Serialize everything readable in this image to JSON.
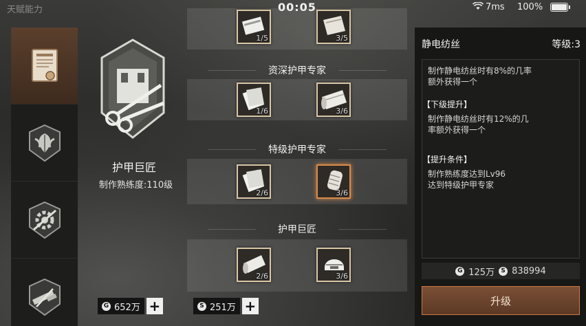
{
  "status_bar": {
    "ghost_text": "天赋能力",
    "time": "00:05",
    "network": "7ms",
    "battery": "100%"
  },
  "sidebar": {
    "categories": [
      {
        "icon": "certificate-icon",
        "active": true
      },
      {
        "icon": "leaf-emblem-icon",
        "active": false
      },
      {
        "icon": "gear-tools-icon",
        "active": false
      },
      {
        "icon": "weapon-tools-icon",
        "active": false
      }
    ]
  },
  "featured": {
    "icon": "armor-tailor-emblem-icon",
    "name": "护甲巨匠",
    "level_text": "制作熟练度:110级"
  },
  "currency": {
    "gold": "652万",
    "silver": "251万",
    "gold_symbol": "G",
    "silver_symbol": "S"
  },
  "tree": {
    "tiers": [
      {
        "title": "",
        "items": [
          {
            "count": "1/5"
          },
          {
            "count": "3/5"
          }
        ]
      },
      {
        "title": "资深护甲专家",
        "items": [
          {
            "count": "1/6"
          },
          {
            "count": "3/6"
          }
        ]
      },
      {
        "title": "特级护甲专家",
        "items": [
          {
            "count": "2/6"
          },
          {
            "count": "3/6"
          }
        ]
      },
      {
        "title": "护甲巨匠",
        "items": [
          {
            "count": "2/6"
          },
          {
            "count": "3/6"
          }
        ]
      }
    ],
    "selected": "tier3-item2"
  },
  "detail": {
    "title": "静电纺丝",
    "level": "等级:3",
    "description": [
      "制作静电纺丝时有8%的几率",
      "额外获得一个"
    ],
    "next_heading": "【下级提升】",
    "next_text": [
      "制作静电纺丝时有12%的几",
      "率额外获得一个"
    ],
    "cond_heading": "【提升条件】",
    "cond_text": [
      "制作熟练度达到Lv96",
      "达到特级护甲专家"
    ],
    "cost_gold": "125万",
    "cost_silver": "838994",
    "upgrade_label": "升级"
  },
  "colors": {
    "accent": "#d07a3e",
    "active_tab": "#5a3f2c",
    "item_border": "#d9c7a6"
  }
}
